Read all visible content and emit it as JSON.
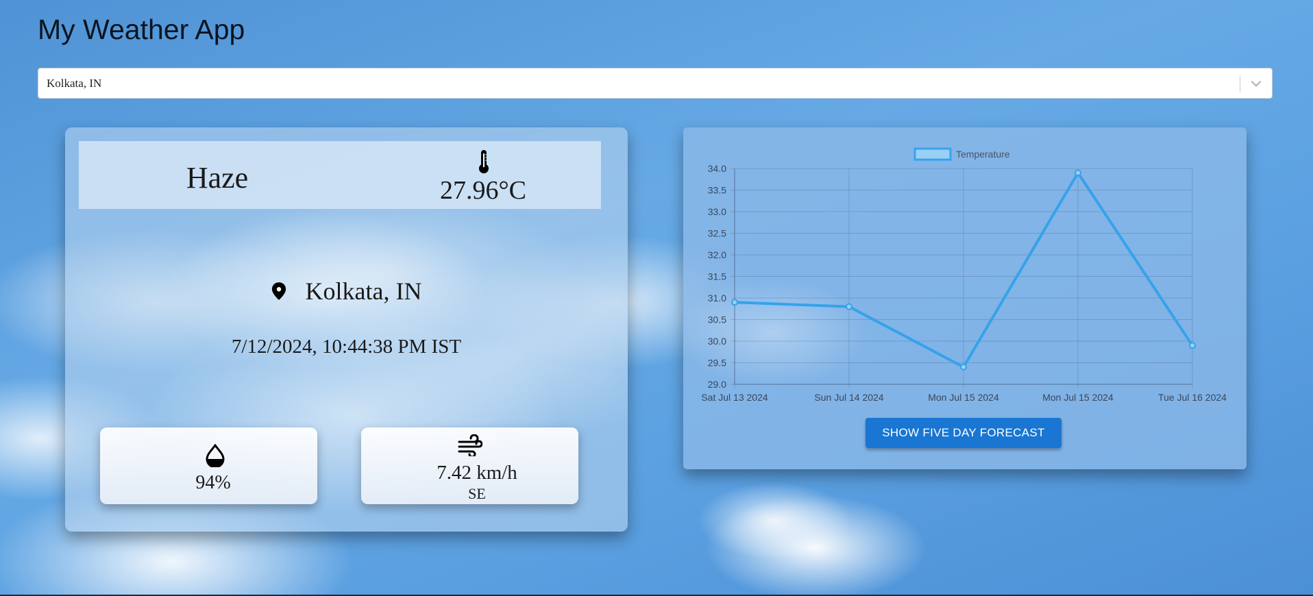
{
  "app": {
    "title": "My Weather App"
  },
  "search": {
    "value": "Kolkata, IN"
  },
  "weather": {
    "condition": "Haze",
    "temperature": "27.96°C",
    "location": "Kolkata, IN",
    "datetime": "7/12/2024, 10:44:38 PM IST",
    "humidity": "94%",
    "wind_speed": "7.42 km/h",
    "wind_direction": "SE"
  },
  "icons": {
    "location": "map-pin-icon",
    "temperature": "thermometer-icon",
    "humidity": "water-drop-icon",
    "wind": "wind-icon",
    "dropdown": "chevron-down-icon"
  },
  "colors": {
    "accent": "#1976d2",
    "line": "#36a2eb",
    "legend_fill": "#9ad0f5"
  },
  "forecast_button": {
    "label": "SHOW FIVE DAY FORECAST"
  },
  "chart_data": {
    "type": "line",
    "legend": [
      "Temperature"
    ],
    "legend_position": "top",
    "grid": true,
    "categories": [
      "Sat Jul 13 2024",
      "Sun Jul 14 2024",
      "Mon Jul 15 2024",
      "Mon Jul 15 2024",
      "Tue Jul 16 2024"
    ],
    "series": [
      {
        "name": "Temperature",
        "values": [
          30.9,
          30.8,
          29.4,
          33.9,
          29.9
        ]
      }
    ],
    "ylim": [
      29.0,
      34.0
    ],
    "yticks": [
      "34.0",
      "33.5",
      "33.0",
      "32.5",
      "32.0",
      "31.5",
      "31.0",
      "30.5",
      "30.0",
      "29.5",
      "29.0"
    ]
  }
}
